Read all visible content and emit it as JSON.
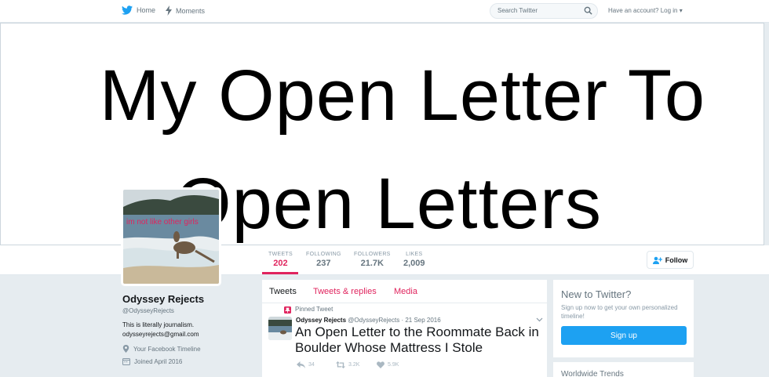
{
  "nav": {
    "home_label": "Home",
    "moments_label": "Moments",
    "search_placeholder": "Search Twitter",
    "login_label": "Have an account? Log in ▾"
  },
  "banner": {
    "line1": "My Open Letter To",
    "line2": "Open Letters"
  },
  "avatar": {
    "caption": "im not like other girls"
  },
  "stats": [
    {
      "label": "TWEETS",
      "value": "202"
    },
    {
      "label": "FOLLOWING",
      "value": "237"
    },
    {
      "label": "FOLLOWERS",
      "value": "21.7K"
    },
    {
      "label": "LIKES",
      "value": "2,009"
    }
  ],
  "follow_label": "Follow",
  "profile": {
    "name": "Odyssey Rejects",
    "handle": "@OdysseyRejects",
    "bio_line1": "This is literally journalism.",
    "bio_line2": "odysseyrejects@gmail.com",
    "location": "Your Facebook Timeline",
    "joined": "Joined April 2016"
  },
  "tabs": [
    "Tweets",
    "Tweets & replies",
    "Media"
  ],
  "tweet": {
    "pinned_label": "Pinned Tweet",
    "author": "Odyssey Rejects",
    "handle": "@OdysseyRejects",
    "date": "· 21 Sep 2016",
    "text": "An Open Letter to the Roommate Back in Boulder Whose Mattress I Stole",
    "replies": "34",
    "retweets": "3.2K",
    "likes": "5.9K"
  },
  "signup_box": {
    "title": "New to Twitter?",
    "text": "Sign up now to get your own personalized timeline!",
    "button": "Sign up"
  },
  "trends": {
    "title": "Worldwide Trends"
  },
  "colors": {
    "accent": "#e0245e",
    "twitter_blue": "#1da1f2",
    "background": "#e6ecf0"
  }
}
